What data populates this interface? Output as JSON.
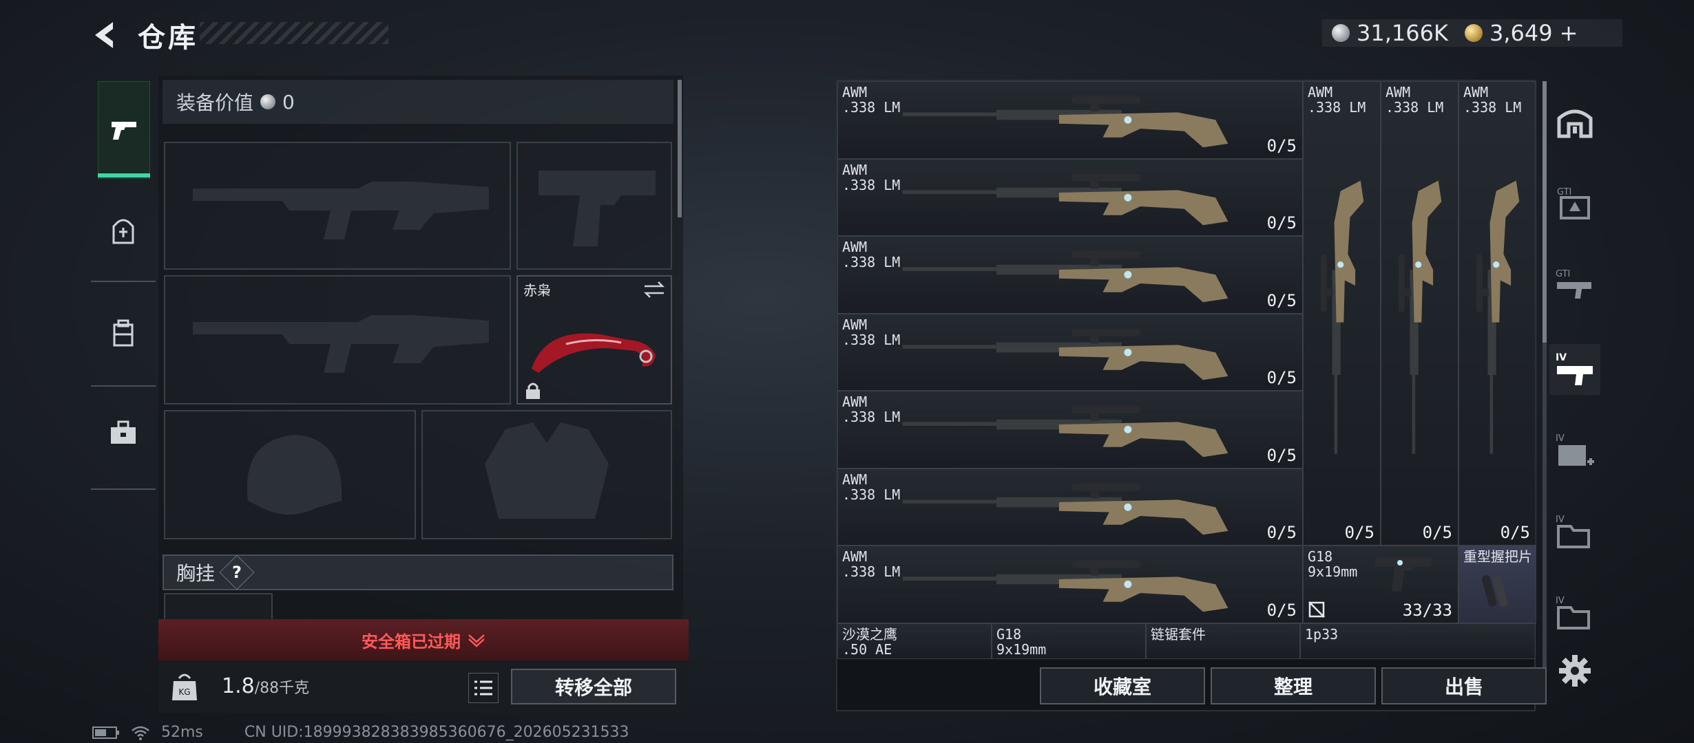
{
  "header": {
    "title": "仓库",
    "silver_amount": "31,166K",
    "gold_amount": "3,649",
    "gold_plus": "+"
  },
  "loadout": {
    "equip_value_label": "装备价值",
    "equip_value": "0",
    "melee_name": "赤枭",
    "chest_label": "胸挂",
    "help_mark": "?",
    "safebox_expired": "安全箱已过期",
    "weight_current": "1.8",
    "weight_max": "/88千克",
    "transfer_all": "转移全部"
  },
  "storage": {
    "awm_rows": [
      {
        "name": "AWM",
        "caliber": ".338 LM",
        "count": "0/5"
      },
      {
        "name": "AWM",
        "caliber": ".338 LM",
        "count": "0/5"
      },
      {
        "name": "AWM",
        "caliber": ".338 LM",
        "count": "0/5"
      },
      {
        "name": "AWM",
        "caliber": ".338 LM",
        "count": "0/5"
      },
      {
        "name": "AWM",
        "caliber": ".338 LM",
        "count": "0/5"
      },
      {
        "name": "AWM",
        "caliber": ".338 LM",
        "count": "0/5"
      },
      {
        "name": "AWM",
        "caliber": ".338 LM",
        "count": "0/5"
      }
    ],
    "awm_vertical": [
      {
        "name": "AWM",
        "caliber": ".338 LM",
        "count": "0/5"
      },
      {
        "name": "AWM",
        "caliber": ".338 LM",
        "count": "0/5"
      },
      {
        "name": "AWM",
        "caliber": ".338 LM",
        "count": "0/5"
      }
    ],
    "g18": {
      "name": "G18",
      "caliber": "9x19mm",
      "count": "33/33"
    },
    "heavy_grip": {
      "name": "重型握把片"
    },
    "bottom_row": [
      {
        "name": "沙漠之鹰",
        "caliber": ".50 AE"
      },
      {
        "name": "G18",
        "caliber": "9x19mm"
      },
      {
        "name": "链锯套件",
        "caliber": ""
      },
      {
        "name": "1p33",
        "caliber": ""
      }
    ]
  },
  "category_tabs": [
    "home-icon",
    "GTI-icon",
    "GTI-2-icon",
    "IV-icon",
    "IV-plus-icon",
    "IV-folder-icon",
    "IV-folder-2-icon"
  ],
  "category_labels": {
    "gti": "GTI",
    "iv": "IV"
  },
  "buttons": {
    "collection": "收藏室",
    "organize": "整理",
    "sell": "出售"
  },
  "status": {
    "ping": "52ms",
    "uid": "CN UID:1899938283839853606​76_202605231533"
  },
  "colors": {
    "accent_green": "#3fd6a6",
    "warning_red": "#ff5a5a",
    "awm_tan": "#8a7a5e"
  }
}
